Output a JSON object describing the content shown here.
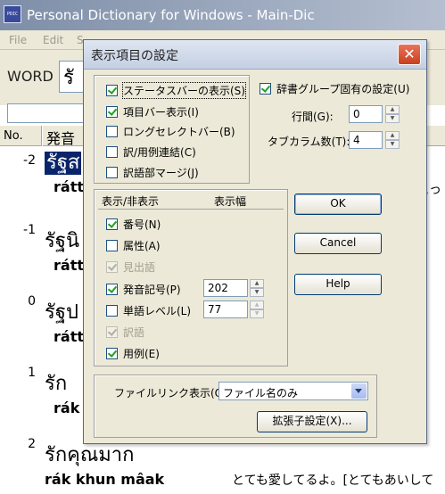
{
  "window": {
    "title": "Personal Dictionary for Windows - Main-Dic",
    "icon_text": "PDIC",
    "menu": [
      "File",
      "Edit",
      "S"
    ],
    "word_label": "WORD",
    "word_value": "รั"
  },
  "list": {
    "col_no": "No.",
    "col_pron": "発音",
    "entries": [
      {
        "num": "-2",
        "thai": "รัฐส",
        "roman": "rátt",
        "meaning": "こっ",
        "selected": true
      },
      {
        "num": "-1",
        "thai": "รัฐนิ",
        "roman": "rátt",
        "meaning": "",
        "selected": false
      },
      {
        "num": "0",
        "thai": "รัฐป",
        "roman": "rátt",
        "meaning": "",
        "selected": false
      },
      {
        "num": "1",
        "thai": "รัก",
        "roman": "rák",
        "meaning": "",
        "selected": false
      },
      {
        "num": "2",
        "thai": "รักคุณมาก",
        "roman": "rák khun mâak",
        "meaning": "とても愛してるよ。[とてもあいして",
        "selected": false
      }
    ]
  },
  "dialog": {
    "title": "表示項目の設定",
    "close_glyph": "✕",
    "top_group": [
      {
        "label": "ステータスバーの表示(S)",
        "checked": true,
        "focused": true
      },
      {
        "label": "項目バー表示(I)",
        "checked": true
      },
      {
        "label": "ロングセレクトバー(B)",
        "checked": false
      },
      {
        "label": "訳/用例連結(C)",
        "checked": false
      },
      {
        "label": "訳語部マージ(J)",
        "checked": false
      }
    ],
    "group_specific": {
      "label": "辞書グループ固有の設定(U)",
      "checked": true
    },
    "line_spacing": {
      "label": "行間(G):",
      "value": "0"
    },
    "tab_columns": {
      "label": "タブカラム数(T):",
      "value": "4"
    },
    "display_group": {
      "head_show": "表示/非表示",
      "head_width": "表示幅",
      "items": [
        {
          "label": "番号(N)",
          "checked": true,
          "disabled": false
        },
        {
          "label": "属性(A)",
          "checked": false,
          "disabled": false
        },
        {
          "label": "見出語",
          "checked": true,
          "disabled": true
        },
        {
          "label": "発音記号(P)",
          "checked": true,
          "disabled": false,
          "width": "202",
          "spin_disabled": false
        },
        {
          "label": "単語レベル(L)",
          "checked": false,
          "disabled": false,
          "width": "77",
          "spin_disabled": true
        },
        {
          "label": "訳語",
          "checked": true,
          "disabled": true
        },
        {
          "label": "用例(E)",
          "checked": true,
          "disabled": false
        }
      ]
    },
    "buttons": {
      "ok": "OK",
      "cancel": "Cancel",
      "help": "Help"
    },
    "file_link": {
      "label": "ファイルリンク表示(O):",
      "value": "ファイル名のみ"
    },
    "ext_button": "拡張子設定(X)..."
  }
}
